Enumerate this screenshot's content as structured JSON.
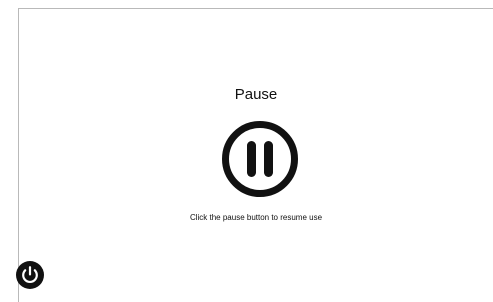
{
  "pause_screen": {
    "title": "Pause",
    "hint": "Click the pause button to resume use",
    "pause_icon": "pause-circle-icon",
    "power_icon": "power-icon"
  },
  "colors": {
    "background": "#ffffff",
    "icon": "#111111",
    "border": "#b9b9b9"
  }
}
